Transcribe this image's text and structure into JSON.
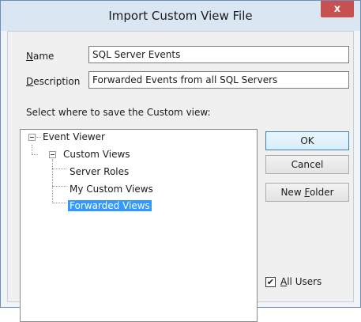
{
  "window": {
    "title": "Import Custom View File",
    "close_glyph": "x"
  },
  "form": {
    "name_label_key": "N",
    "name_label_rest": "ame",
    "name_value": "SQL Server Events",
    "description_label_key": "D",
    "description_label_rest": "escription",
    "description_value": "Forwarded Events from all SQL Servers",
    "save_location_label": "Select where to save the Custom view:"
  },
  "tree": {
    "nodes": [
      {
        "label": "Event Viewer",
        "expanded": true
      },
      {
        "label": "Custom Views",
        "expanded": true
      },
      {
        "label": "Server Roles"
      },
      {
        "label": "My Custom Views"
      },
      {
        "label": "Forwarded Views",
        "selected": true
      }
    ]
  },
  "buttons": {
    "ok": "OK",
    "cancel": "Cancel",
    "new_folder_prefix": "New ",
    "new_folder_key": "F",
    "new_folder_rest": "older"
  },
  "all_users": {
    "checked": true,
    "check_glyph": "✔",
    "label_key": "A",
    "label_rest": "ll Users"
  }
}
